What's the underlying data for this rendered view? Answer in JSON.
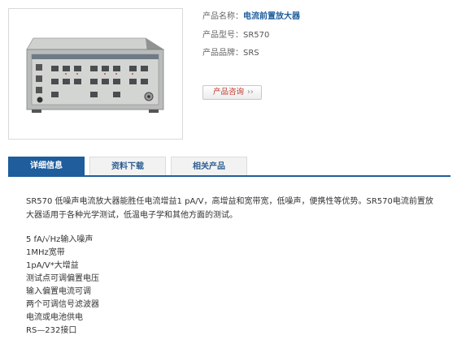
{
  "product": {
    "name_label": "产品名称：",
    "name_value": "电流前置放大器",
    "model_label": "产品型号：",
    "model_value": "SR570",
    "brand_label": "产品品牌：",
    "brand_value": "SRS"
  },
  "inquiry_button": {
    "label": "产品咨询",
    "arrows": "››"
  },
  "tabs": [
    {
      "label": "详细信息",
      "active": true
    },
    {
      "label": "资料下载",
      "active": false
    },
    {
      "label": "相关产品",
      "active": false
    }
  ],
  "description": "SR570 低噪声电流放大器能胜任电流增益1 pA/V，高增益和宽带宽，低噪声，便携性等优势。SR570电流前置放大器适用于各种光学测试，低温电子学和其他方面的测试。",
  "features": [
    "5 fA/√Hz输入噪声",
    "1MHz宽带",
    "1pA/V*大增益",
    "测试点可调偏置电压",
    "输入偏置电流可调",
    "两个可调信号滤波器",
    "电流或电池供电",
    "RS—232接口"
  ],
  "colors": {
    "accent": "#1f5d9c",
    "inquiry_text": "#c0392b"
  }
}
